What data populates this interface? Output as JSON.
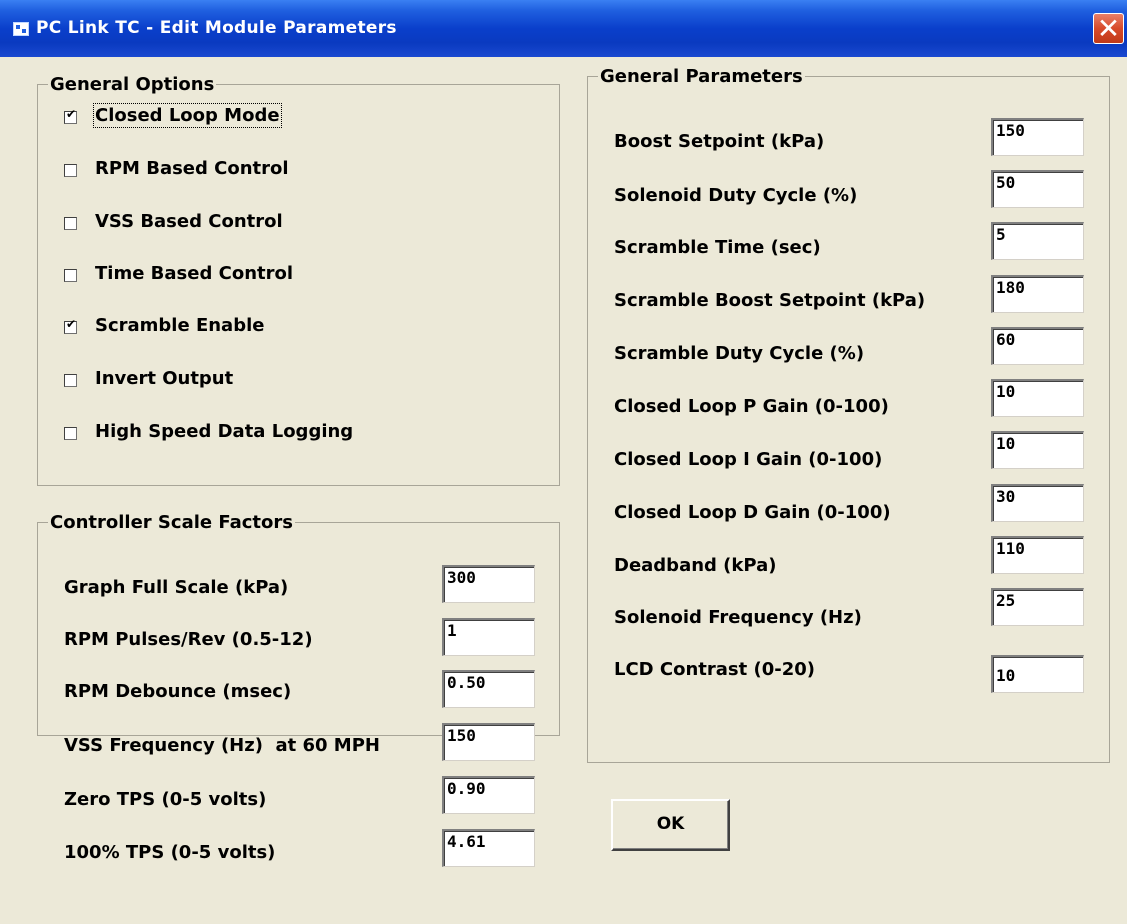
{
  "window": {
    "title": "PC Link TC - Edit Module Parameters",
    "close_glyph": "✕"
  },
  "general_options": {
    "title": "General Options",
    "items": [
      {
        "label": "Closed Loop Mode",
        "checked": true
      },
      {
        "label": "RPM Based Control",
        "checked": false
      },
      {
        "label": "VSS Based Control",
        "checked": false
      },
      {
        "label": "Time Based Control",
        "checked": false
      },
      {
        "label": "Scramble Enable",
        "checked": true
      },
      {
        "label": "Invert Output",
        "checked": false
      },
      {
        "label": "High Speed Data Logging",
        "checked": false
      }
    ]
  },
  "scale_factors": {
    "title": "Controller Scale Factors",
    "fields": [
      {
        "label": "Graph Full Scale (kPa)",
        "value": "300"
      },
      {
        "label": "RPM Pulses/Rev (0.5-12)",
        "value": "1"
      },
      {
        "label": "RPM Debounce (msec)",
        "value": "0.50"
      },
      {
        "label": "VSS Frequency (Hz)  at 60 MPH",
        "value": "150"
      },
      {
        "label": "Zero TPS (0-5 volts)",
        "value": "0.90"
      },
      {
        "label": "100% TPS (0-5 volts)",
        "value": "4.61"
      }
    ]
  },
  "general_parameters": {
    "title": "General Parameters",
    "fields": [
      {
        "label": "Boost Setpoint (kPa)",
        "value": "150"
      },
      {
        "label": "Solenoid Duty Cycle (%)",
        "value": "50"
      },
      {
        "label": "Scramble Time (sec)",
        "value": "5"
      },
      {
        "label": "Scramble Boost Setpoint (kPa)",
        "value": "180"
      },
      {
        "label": "Scramble Duty Cycle (%)",
        "value": "60"
      },
      {
        "label": "Closed Loop P Gain (0-100)",
        "value": "10"
      },
      {
        "label": "Closed Loop I Gain (0-100)",
        "value": "10"
      },
      {
        "label": "Closed Loop D Gain (0-100)",
        "value": "30"
      },
      {
        "label": "Deadband (kPa)",
        "value": "110"
      },
      {
        "label": "Solenoid Frequency (Hz)",
        "value": "25"
      },
      {
        "label": "LCD Contrast (0-20)",
        "value": "10"
      }
    ]
  },
  "ok_button": {
    "label": "OK"
  },
  "colors": {
    "window_bg": "#ECE9D8",
    "titlebar": "#0A3FCB",
    "close_button": "#D84A2A"
  }
}
